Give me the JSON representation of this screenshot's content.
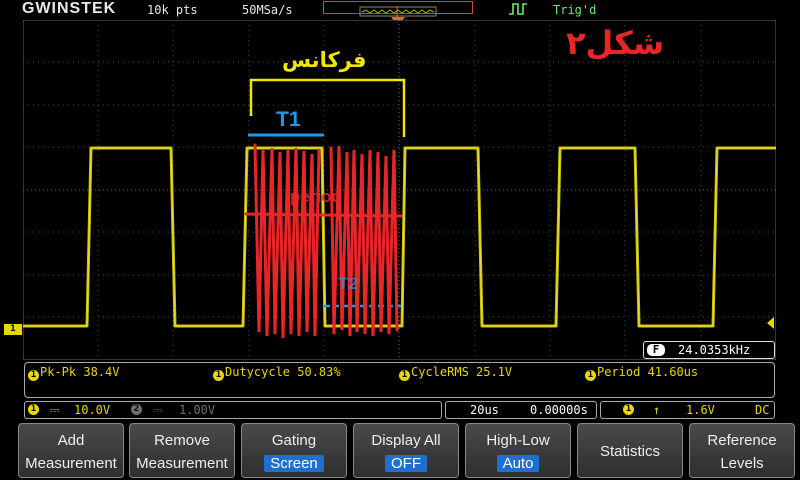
{
  "topbar": {
    "logo": "GWINSTEK",
    "record_length": "10k pts",
    "sample_rate": "50MSa/s",
    "trigger_status": "Trig'd"
  },
  "annotations": {
    "figure_label": "شکل۲",
    "frequency_label": "فرکانس",
    "t1_label": "T1",
    "scribble_word": "period",
    "t2_label": "T2",
    "colors": {
      "yellow": "#f2e600",
      "blue": "#1e9be6",
      "red": "#e8262a"
    }
  },
  "counter": {
    "icon": "F",
    "value": "24.0353kHz"
  },
  "measurements": [
    {
      "channel": "1",
      "label": "Pk-Pk 38.4V"
    },
    {
      "channel": "1",
      "label": "Dutycycle 50.83%"
    },
    {
      "channel": "1",
      "label": "CycleRMS 25.1V"
    },
    {
      "channel": "1",
      "label": "Period 41.60us"
    }
  ],
  "channel_bar": {
    "ch1_badge": "1",
    "ch1_coupling_icon": "dc-coupling-icon",
    "ch1_scale": "10.0V",
    "ch2_badge": "2",
    "ch2_scale": "1.00V",
    "timebase": "20us",
    "position": "0.00000s",
    "trig_source": "1",
    "trig_slope_icon": "rising-edge-icon",
    "trig_level": "1.6V",
    "trig_coupling": "DC"
  },
  "menu": [
    {
      "line1": "Add",
      "line2": "Measurement"
    },
    {
      "line1": "Remove",
      "line2": "Measurement"
    },
    {
      "line1": "Gating",
      "value": "Screen"
    },
    {
      "line1": "Display All",
      "value": "OFF"
    },
    {
      "line1": "High-Low",
      "value": "Auto"
    },
    {
      "single": "Statistics"
    },
    {
      "line1": "Reference",
      "line2": "Levels"
    }
  ],
  "channel_color": "#e6d800"
}
